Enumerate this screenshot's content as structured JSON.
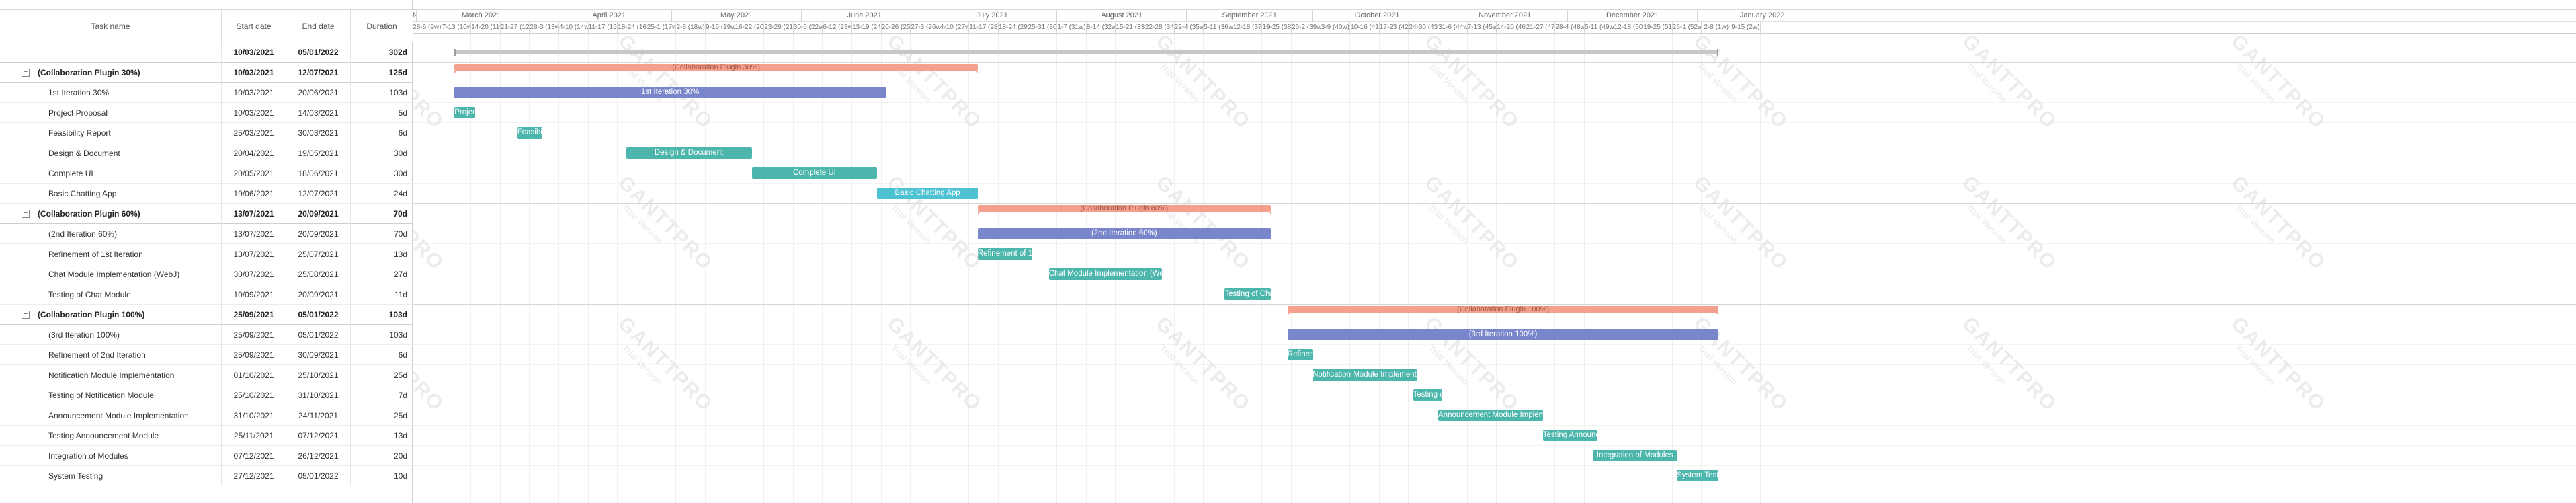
{
  "grid": {
    "columns": {
      "name": "Task name",
      "start": "Start date",
      "end": "End date",
      "duration": "Duration"
    },
    "rows": [
      {
        "type": "total",
        "name": "",
        "start": "10/03/2021",
        "end": "05/01/2022",
        "duration": "302d"
      },
      {
        "type": "group",
        "name": "(Collaboration Plugin 30%)",
        "start": "10/03/2021",
        "end": "12/07/2021",
        "duration": "125d"
      },
      {
        "type": "task",
        "name": "1st Iteration 30%",
        "start": "10/03/2021",
        "end": "20/06/2021",
        "duration": "103d"
      },
      {
        "type": "task",
        "name": "Project Proposal",
        "start": "10/03/2021",
        "end": "14/03/2021",
        "duration": "5d"
      },
      {
        "type": "task",
        "name": "Feasibility Report",
        "start": "25/03/2021",
        "end": "30/03/2021",
        "duration": "6d"
      },
      {
        "type": "task",
        "name": "Design & Document",
        "start": "20/04/2021",
        "end": "19/05/2021",
        "duration": "30d"
      },
      {
        "type": "task",
        "name": "Complete UI",
        "start": "20/05/2021",
        "end": "18/06/2021",
        "duration": "30d"
      },
      {
        "type": "task",
        "name": "Basic Chatting App",
        "start": "19/06/2021",
        "end": "12/07/2021",
        "duration": "24d"
      },
      {
        "type": "group",
        "name": "(Collaboration Plugin 60%)",
        "start": "13/07/2021",
        "end": "20/09/2021",
        "duration": "70d"
      },
      {
        "type": "task",
        "name": "(2nd Iteration 60%)",
        "start": "13/07/2021",
        "end": "20/09/2021",
        "duration": "70d"
      },
      {
        "type": "task",
        "name": "Refinement of 1st Iteration",
        "start": "13/07/2021",
        "end": "25/07/2021",
        "duration": "13d"
      },
      {
        "type": "task",
        "name": "Chat Module Implementation (WebJ)",
        "start": "30/07/2021",
        "end": "25/08/2021",
        "duration": "27d"
      },
      {
        "type": "task",
        "name": "Testing of Chat Module",
        "start": "10/09/2021",
        "end": "20/09/2021",
        "duration": "11d"
      },
      {
        "type": "group",
        "name": "(Collaboration Plugin 100%)",
        "start": "25/09/2021",
        "end": "05/01/2022",
        "duration": "103d"
      },
      {
        "type": "task",
        "name": "(3rd Iteration 100%)",
        "start": "25/09/2021",
        "end": "05/01/2022",
        "duration": "103d"
      },
      {
        "type": "task",
        "name": "Refinement of 2nd Iteration",
        "start": "25/09/2021",
        "end": "30/09/2021",
        "duration": "6d"
      },
      {
        "type": "task",
        "name": "Notification Module Implementation",
        "start": "01/10/2021",
        "end": "25/10/2021",
        "duration": "25d"
      },
      {
        "type": "task",
        "name": "Testing of Notification Module",
        "start": "25/10/2021",
        "end": "31/10/2021",
        "duration": "7d"
      },
      {
        "type": "task",
        "name": "Announcement Module Implementation",
        "start": "31/10/2021",
        "end": "24/11/2021",
        "duration": "25d"
      },
      {
        "type": "task",
        "name": "Testing Announcement Module",
        "start": "25/11/2021",
        "end": "07/12/2021",
        "duration": "13d"
      },
      {
        "type": "task",
        "name": "Integration of Modules",
        "start": "07/12/2021",
        "end": "26/12/2021",
        "duration": "20d"
      },
      {
        "type": "task",
        "name": "System Testing",
        "start": "27/12/2021",
        "end": "05/01/2022",
        "duration": "10d"
      }
    ]
  },
  "timescale": {
    "months": [
      "N",
      "March 2021",
      "April 2021",
      "May 2021",
      "June 2021",
      "July 2021",
      "August 2021",
      "September 2021",
      "October 2021",
      "November 2021",
      "December 2021",
      "January 2022"
    ],
    "weeks": [
      "28-6 (9w)",
      "7-13 (10w)",
      "14-20 (11w)",
      "21-27 (12w)",
      "28-3 (13w)",
      "4-10 (14w)",
      "11-17 (15w)",
      "18-24 (16w)",
      "25-1 (17w)",
      "2-8 (18w)",
      "9-15 (19w)",
      "16-22 (20w)",
      "23-29 (21w)",
      "30-5 (22w)",
      "6-12 (23w)",
      "13-19 (24w)",
      "20-26 (25w)",
      "27-3 (26w)",
      "4-10 (27w)",
      "11-17 (28w)",
      "18-24 (29w)",
      "25-31 (30w)",
      "1-7 (31w)",
      "8-14 (32w)",
      "15-21 (33w)",
      "22-28 (34w)",
      "29-4 (35w)",
      "5-11 (36w)",
      "12-18 (37w)",
      "19-25 (38w)",
      "26-2 (39w)",
      "3-9 (40w)",
      "10-16 (41w)",
      "17-23 (42w)",
      "24-30 (43w)",
      "31-6 (44w)",
      "7-13 (45w)",
      "14-20 (46w)",
      "21-27 (47w)",
      "28-4 (48w)",
      "5-11 (49w)",
      "12-18 (50w)",
      "19-25 (51w)",
      "26-1 (52w)",
      "2-8 (1w)",
      "9-15 (2w)"
    ]
  },
  "bars": [
    {
      "row": 1,
      "kind": "proj",
      "start": "2021-03-10",
      "end": "2021-07-12",
      "label": "(Collaboration Plugin 30%)"
    },
    {
      "row": 2,
      "kind": "iter",
      "start": "2021-03-10",
      "end": "2021-06-20",
      "label": "1st Iteration 30%"
    },
    {
      "row": 3,
      "kind": "task",
      "start": "2021-03-10",
      "end": "2021-03-14",
      "label": "Projec..."
    },
    {
      "row": 4,
      "kind": "task",
      "start": "2021-03-25",
      "end": "2021-03-30",
      "label": "Feasibil..."
    },
    {
      "row": 5,
      "kind": "task",
      "start": "2021-04-20",
      "end": "2021-05-19",
      "label": "Design & Document"
    },
    {
      "row": 6,
      "kind": "task",
      "start": "2021-05-20",
      "end": "2021-06-18",
      "label": "Complete UI"
    },
    {
      "row": 7,
      "kind": "app",
      "start": "2021-06-19",
      "end": "2021-07-12",
      "label": "Basic Chatting App"
    },
    {
      "row": 8,
      "kind": "proj",
      "start": "2021-07-13",
      "end": "2021-09-20",
      "label": "(Collaboration Plugin 60%)"
    },
    {
      "row": 9,
      "kind": "iter",
      "start": "2021-07-13",
      "end": "2021-09-20",
      "label": "(2nd Iteration 60%)"
    },
    {
      "row": 10,
      "kind": "task",
      "start": "2021-07-13",
      "end": "2021-07-25",
      "label": "Refinement of 1st Iter..."
    },
    {
      "row": 11,
      "kind": "task",
      "start": "2021-07-30",
      "end": "2021-08-25",
      "label": "Chat Module Implementation (WebJ)"
    },
    {
      "row": 12,
      "kind": "task",
      "start": "2021-09-10",
      "end": "2021-09-20",
      "label": "Testing of Chat M..."
    },
    {
      "row": 13,
      "kind": "proj",
      "start": "2021-09-25",
      "end": "2022-01-05",
      "label": "(Collaboration Plugin 100%)"
    },
    {
      "row": 14,
      "kind": "iter",
      "start": "2021-09-25",
      "end": "2022-01-05",
      "label": "(3rd Iteration 100%)"
    },
    {
      "row": 15,
      "kind": "task",
      "start": "2021-09-25",
      "end": "2021-09-30",
      "label": "Refinem..."
    },
    {
      "row": 16,
      "kind": "task",
      "start": "2021-10-01",
      "end": "2021-10-25",
      "label": "Notification Module Implementation"
    },
    {
      "row": 17,
      "kind": "task",
      "start": "2021-10-25",
      "end": "2021-10-31",
      "label": "Testing of ..."
    },
    {
      "row": 18,
      "kind": "task",
      "start": "2021-10-31",
      "end": "2021-11-24",
      "label": "Announcement Module Implementation"
    },
    {
      "row": 19,
      "kind": "task",
      "start": "2021-11-25",
      "end": "2021-12-07",
      "label": "Testing Announceme..."
    },
    {
      "row": 20,
      "kind": "task",
      "start": "2021-12-07",
      "end": "2021-12-26",
      "label": "Integration of Modules"
    },
    {
      "row": 21,
      "kind": "task",
      "start": "2021-12-27",
      "end": "2022-01-05",
      "label": "System Testing"
    }
  ],
  "watermark": {
    "title": "GANTTPRO",
    "subtitle": "Trial Version"
  },
  "colors": {
    "task": "#4db6ac",
    "iteration": "#7986cb",
    "chatting_app": "#4dc3d2",
    "project": "#f4a08c",
    "total": "#c7c7c7"
  }
}
